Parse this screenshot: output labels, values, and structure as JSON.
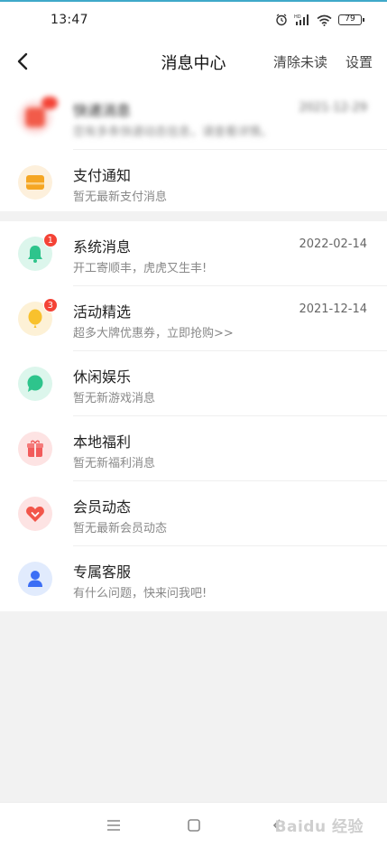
{
  "status_bar": {
    "time": "13:47",
    "battery": "79",
    "network": "HD"
  },
  "header": {
    "title": "消息中心",
    "clear_unread": "清除未读",
    "settings": "设置"
  },
  "section1": [
    {
      "name": "快递消息",
      "sub": "您有多条快递动态信息，请查看详情。",
      "date": "2021-12-29",
      "icon": "package-icon",
      "blurred": true
    },
    {
      "name": "支付通知",
      "sub": "暂无最新支付消息",
      "date": "",
      "icon": "wallet-icon"
    }
  ],
  "section2": [
    {
      "name": "系统消息",
      "sub": "开工寄顺丰，虎虎又生丰!",
      "date": "2022-02-14",
      "badge": "1",
      "icon": "bell-icon"
    },
    {
      "name": "活动精选",
      "sub": "超多大牌优惠券，立即抢购>>",
      "date": "2021-12-14",
      "badge": "3",
      "icon": "balloon-icon"
    },
    {
      "name": "休闲娱乐",
      "sub": "暂无新游戏消息",
      "date": "",
      "icon": "chat-bubble-icon"
    },
    {
      "name": "本地福利",
      "sub": "暂无新福利消息",
      "date": "",
      "icon": "gift-icon"
    },
    {
      "name": "会员动态",
      "sub": "暂无最新会员动态",
      "date": "",
      "icon": "heart-icon"
    },
    {
      "name": "专属客服",
      "sub": "有什么问题，快来问我吧!",
      "date": "",
      "icon": "user-icon"
    }
  ],
  "watermark": "Baidu 经验",
  "colors": {
    "badge": "#f44336",
    "accent_line": "#3fa9c9"
  }
}
